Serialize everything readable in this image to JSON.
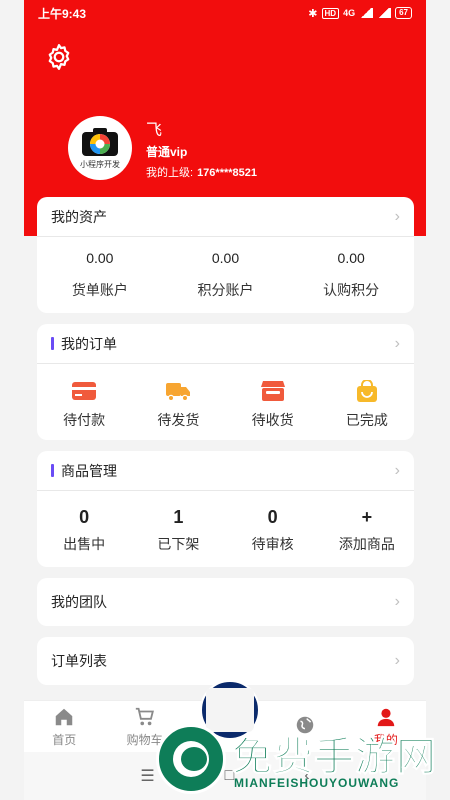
{
  "status_bar": {
    "time": "上午9:43",
    "battery": "67",
    "network": "4G",
    "hd": "HD"
  },
  "profile": {
    "name": "飞",
    "level": "普通vip",
    "superior_label": "我的上级:",
    "superior_value": "176****8521",
    "avatar_caption": "小程序开发"
  },
  "assets": {
    "title": "我的资产",
    "items": [
      {
        "value": "0.00",
        "label": "货单账户"
      },
      {
        "value": "0.00",
        "label": "积分账户"
      },
      {
        "value": "0.00",
        "label": "认购积分"
      }
    ]
  },
  "orders": {
    "title": "我的订单",
    "items": [
      {
        "label": "待付款",
        "icon": "card-icon",
        "color": "#f05a3c"
      },
      {
        "label": "待发货",
        "icon": "truck-icon",
        "color": "#f7a531"
      },
      {
        "label": "待收货",
        "icon": "shop-icon",
        "color": "#f05a3c"
      },
      {
        "label": "已完成",
        "icon": "bag-icon",
        "color": "#f7b92a"
      }
    ]
  },
  "goods": {
    "title": "商品管理",
    "items": [
      {
        "value": "0",
        "label": "出售中"
      },
      {
        "value": "1",
        "label": "已下架"
      },
      {
        "value": "0",
        "label": "待审核"
      },
      {
        "value": "+",
        "label": "添加商品"
      }
    ]
  },
  "menu": {
    "team": "我的团队",
    "order_list": "订单列表"
  },
  "tabbar": {
    "items": [
      {
        "label": "首页",
        "icon": "home-icon"
      },
      {
        "label": "购物车",
        "icon": "cart-icon"
      },
      {
        "label": "",
        "icon": ""
      },
      {
        "label": "",
        "icon": "globe-icon"
      },
      {
        "label": "我的",
        "icon": "user-icon"
      }
    ],
    "active_color": "#e21818"
  },
  "system_nav": {
    "menu": "☰",
    "home": "□",
    "back": "‹"
  },
  "watermark": {
    "title": "免费手游网",
    "subtitle": "MIANFEISHOUYOUWANG"
  },
  "colors": {
    "header_red": "#f20d0d",
    "accent_bar": "#6a4cf5"
  }
}
